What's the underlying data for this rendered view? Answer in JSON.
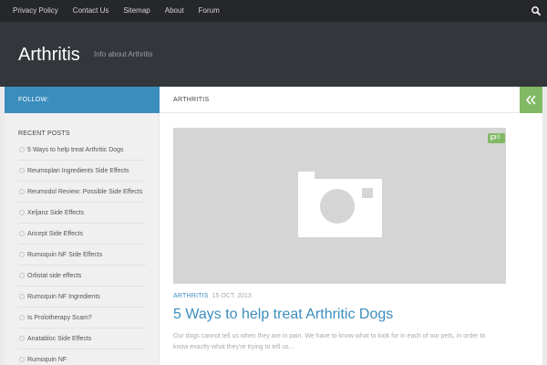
{
  "topnav": {
    "items": [
      "Privacy Policy",
      "Contact Us",
      "Sitemap",
      "About",
      "Forum"
    ]
  },
  "header": {
    "site_title": "Arthritis",
    "tagline": "Info about Arthritis"
  },
  "sidebar": {
    "follow_label": "FOLLOW:",
    "recent_posts_title": "RECENT POSTS",
    "posts": [
      "5 Ways to help treat Arthritic Dogs",
      "Reumoplan Ingredients Side Effects",
      "Reumodol Review: Possible Side Effects",
      "Xeljanz Side Effects",
      "Aricept Side Effects",
      "Rumoquin NF Side Effects",
      "Orlistat side effects",
      "Rumoquin NF Ingredients",
      "Is Prolotherapy Scam?",
      "Anatabloc Side Effects",
      "Rumoquin NF"
    ]
  },
  "main": {
    "page_label": "ARTHRITIS",
    "post": {
      "comment_count": "0",
      "category": "ARTHRITIS",
      "date": "15 OCT, 2013",
      "title": "5 Ways to help treat Arthritic Dogs",
      "excerpt": "Our dogs cannot tell us when they are in pain. We have to know what to look for in each of our pets, in order to know exactly what they're trying to tell us..."
    }
  },
  "colors": {
    "accent_blue": "#3b8dbd",
    "accent_green": "#82b965",
    "topbar": "#26272b",
    "header": "#33363b"
  },
  "icons": {
    "search": "search-icon",
    "collapse": "double-chevron-left-icon",
    "comment": "comment-icon",
    "thumbnail": "camera-icon",
    "bullet": "circle-bullet-icon"
  }
}
